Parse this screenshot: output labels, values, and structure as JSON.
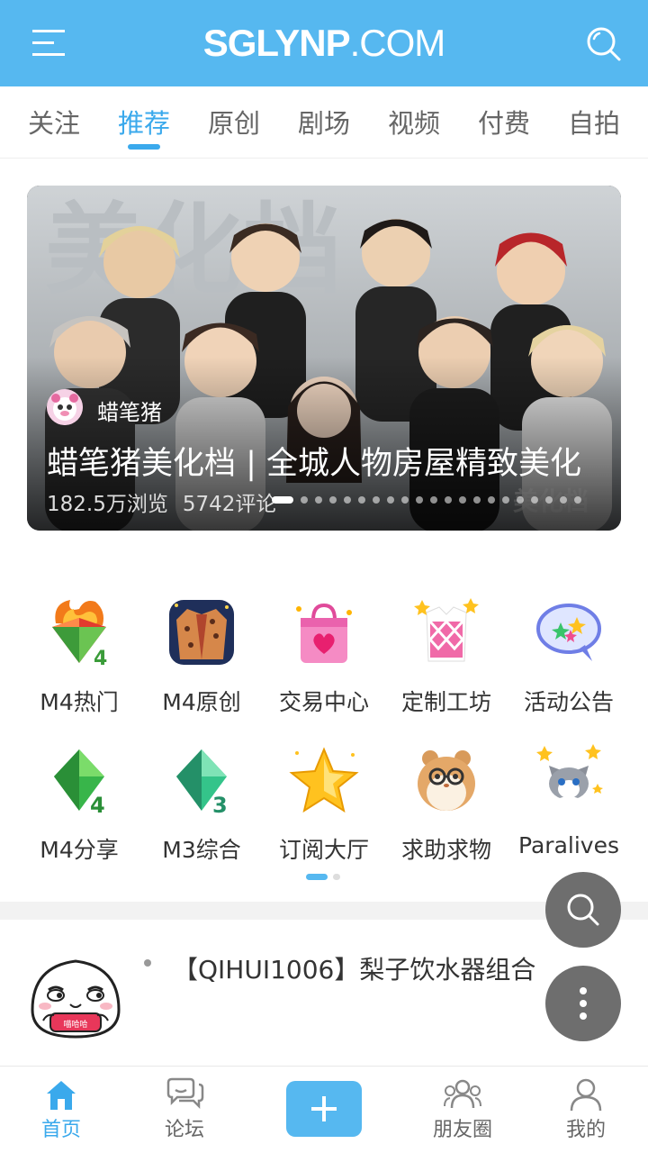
{
  "header": {
    "logo_main": "SGLYNP",
    "logo_suffix": ".COM",
    "accent": "#56b8f0"
  },
  "tabs": [
    {
      "label": "关注"
    },
    {
      "label": "推荐",
      "active": true
    },
    {
      "label": "原创"
    },
    {
      "label": "剧场"
    },
    {
      "label": "视频"
    },
    {
      "label": "付费"
    },
    {
      "label": "自拍"
    }
  ],
  "banner": {
    "author": "蜡笔猪",
    "title": "蜡笔猪美化档 | 全城人物房屋精致美化",
    "views": "182.5万浏览",
    "comments": "5742评论",
    "slide_count": 21,
    "active_slide": 0
  },
  "categories": [
    {
      "label": "M4热门",
      "icon": "fire-diamond-icon"
    },
    {
      "label": "M4原创",
      "icon": "jacket-icon"
    },
    {
      "label": "交易中心",
      "icon": "shopping-bag-icon"
    },
    {
      "label": "定制工坊",
      "icon": "sweater-icon"
    },
    {
      "label": "活动公告",
      "icon": "speech-bubble-stars-icon"
    },
    {
      "label": "M4分享",
      "icon": "green-diamond-4-icon"
    },
    {
      "label": "M3综合",
      "icon": "green-diamond-3-icon"
    },
    {
      "label": "订阅大厅",
      "icon": "star-icon"
    },
    {
      "label": "求助求物",
      "icon": "hamster-icon"
    },
    {
      "label": "Paralives",
      "icon": "cat-stars-icon"
    }
  ],
  "grid_pages": 2,
  "post": {
    "title": "【QIHUI1006】梨子饮水器组合",
    "thumb_badge": "喵哈哈"
  },
  "nav": {
    "home": "首页",
    "forum": "论坛",
    "friends": "朋友圈",
    "me": "我的"
  }
}
